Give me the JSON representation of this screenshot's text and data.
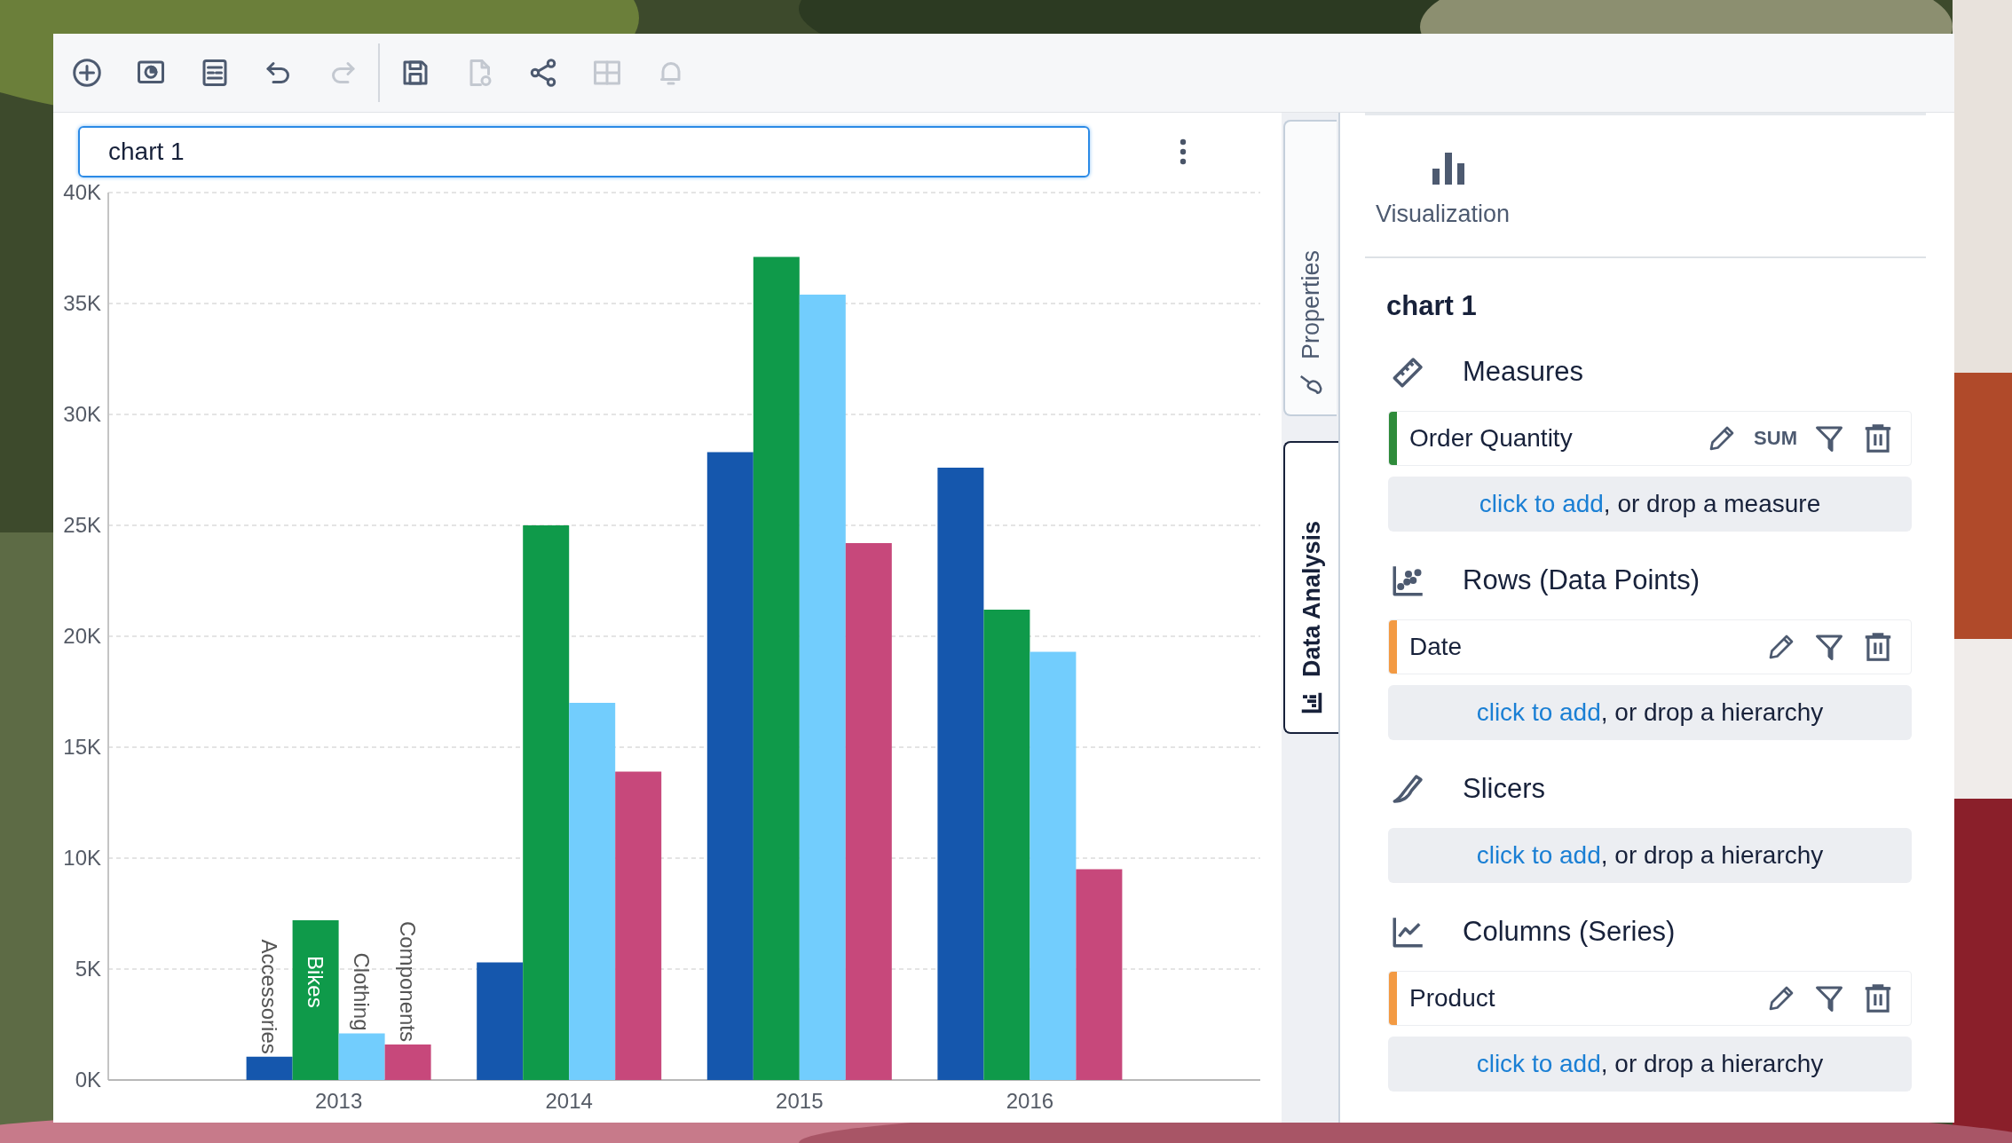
{
  "toolbar": [
    {
      "disabled": false
    },
    {
      "disabled": false
    },
    {
      "disabled": false
    },
    {
      "disabled": false
    },
    {
      "disabled": true
    },
    {
      "disabled": false
    },
    {
      "disabled": true
    },
    {
      "disabled": false
    },
    {
      "disabled": true
    },
    {
      "disabled": true
    }
  ],
  "title_field": {
    "value": "chart 1"
  },
  "chart_data": {
    "type": "bar",
    "categories": [
      "2013",
      "2014",
      "2015",
      "2016"
    ],
    "series": [
      {
        "name": "Accessories",
        "color": "#1557ad",
        "values": [
          1050,
          5300,
          28300,
          27600
        ]
      },
      {
        "name": "Bikes",
        "color": "#0f9a4a",
        "values": [
          7200,
          25000,
          37100,
          21200
        ]
      },
      {
        "name": "Clothing",
        "color": "#72cdfd",
        "values": [
          2100,
          17000,
          35400,
          19300
        ]
      },
      {
        "name": "Components",
        "color": "#c7487b",
        "values": [
          1600,
          13900,
          24200,
          9500
        ]
      }
    ],
    "ylim": [
      0,
      40000
    ],
    "grid": true,
    "yticks": [
      {
        "value": 0,
        "label": "0K"
      },
      {
        "value": 5000,
        "label": "5K"
      },
      {
        "value": 10000,
        "label": "10K"
      },
      {
        "value": 15000,
        "label": "15K"
      },
      {
        "value": 20000,
        "label": "20K"
      },
      {
        "value": 25000,
        "label": "25K"
      },
      {
        "value": 30000,
        "label": "30K"
      },
      {
        "value": 35000,
        "label": "35K"
      },
      {
        "value": 40000,
        "label": "40K"
      }
    ]
  },
  "side_tabs": [
    {
      "label": "Properties",
      "selected": false
    },
    {
      "label": "Data Analysis",
      "selected": true
    }
  ],
  "panel": {
    "visualization": "Visualization",
    "title": "chart 1",
    "sections": [
      {
        "title": "Measures",
        "fields": [
          {
            "name": "Order Quantity",
            "color": "#2e8b3a",
            "aggregation": "SUM"
          }
        ],
        "link": "click to add",
        "hint": ", or drop a measure"
      },
      {
        "title": "Rows (Data Points)",
        "fields": [
          {
            "name": "Date",
            "color": "#f39a43"
          }
        ],
        "link": "click to add",
        "hint": ", or drop a hierarchy"
      },
      {
        "title": "Slicers",
        "link": "click to add",
        "hint": ", or drop a hierarchy"
      },
      {
        "title": "Columns (Series)",
        "fields": [
          {
            "name": "Product",
            "color": "#f39a43"
          }
        ],
        "link": "click to add",
        "hint": ", or drop a hierarchy"
      }
    ]
  }
}
